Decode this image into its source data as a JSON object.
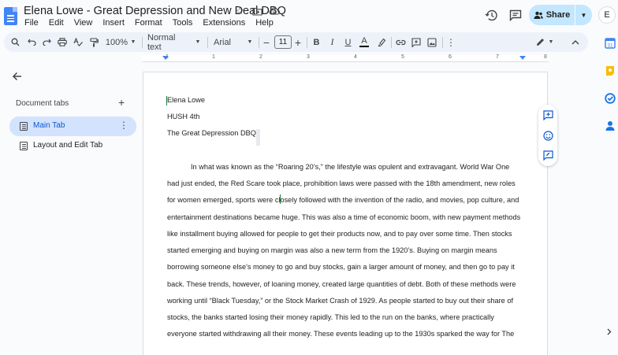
{
  "window": {
    "title": "Elena Lowe - Great Depression and New Deal DBQ"
  },
  "menu": [
    "File",
    "Edit",
    "View",
    "Insert",
    "Format",
    "Tools",
    "Extensions",
    "Help"
  ],
  "share": {
    "label": "Share"
  },
  "avatar": {
    "initial": "E"
  },
  "toolbar": {
    "zoom": "100%",
    "style": "Normal text",
    "font": "Arial",
    "font_size": "11",
    "minus": "−",
    "plus": "+"
  },
  "ruler": {
    "numbers": [
      "1",
      "1",
      "2",
      "3",
      "4",
      "5",
      "6",
      "7",
      "8"
    ]
  },
  "sidebar": {
    "title": "Document tabs",
    "tabs": [
      {
        "label": "Main Tab",
        "active": true
      },
      {
        "label": "Layout and Edit Tab",
        "active": false
      }
    ]
  },
  "document": {
    "header_lines": [
      "Elena Lowe",
      "HUSH 4th",
      "The Great Depression DBQ"
    ],
    "paragraph_lines": [
      "In what was known as the “Roaring 20’s,” the lifestyle was opulent and extravagant. World War One",
      "had just ended, the Red Scare took place, prohibition laws were passed with the 18th amendment, new roles",
      "for women emerged, sports were closely followed with the invention of the radio, and movies, pop culture, and",
      "entertainment destinations became huge. This was also a time of economic boom, with new payment methods",
      "like installment buying allowed for people to get their products now, and to pay over some time. Then stocks",
      "started emerging and buying on margin was also a new term from the 1920’s. Buying on margin means",
      "borrowing someone else's money to go and buy stocks, gain a larger amount of money, and then go to pay it",
      "back. These trends, however, of loaning money, created large quantities of debt. Both of these methods were",
      "working until “Black Tuesday,” or the Stock Market Crash of 1929. As people started to buy out their share of",
      "stocks, the banks started losing their money rapidly. This led to the run on the banks, where practically",
      "everyone started withdrawing all their money. These events leading up to the 1930s sparked the way for The"
    ]
  },
  "colors": {
    "accent": "#0b57d0",
    "share_bg": "#c2e7ff",
    "active_tab_bg": "#d3e3fd",
    "toolbar_bg": "#edf2fa"
  }
}
